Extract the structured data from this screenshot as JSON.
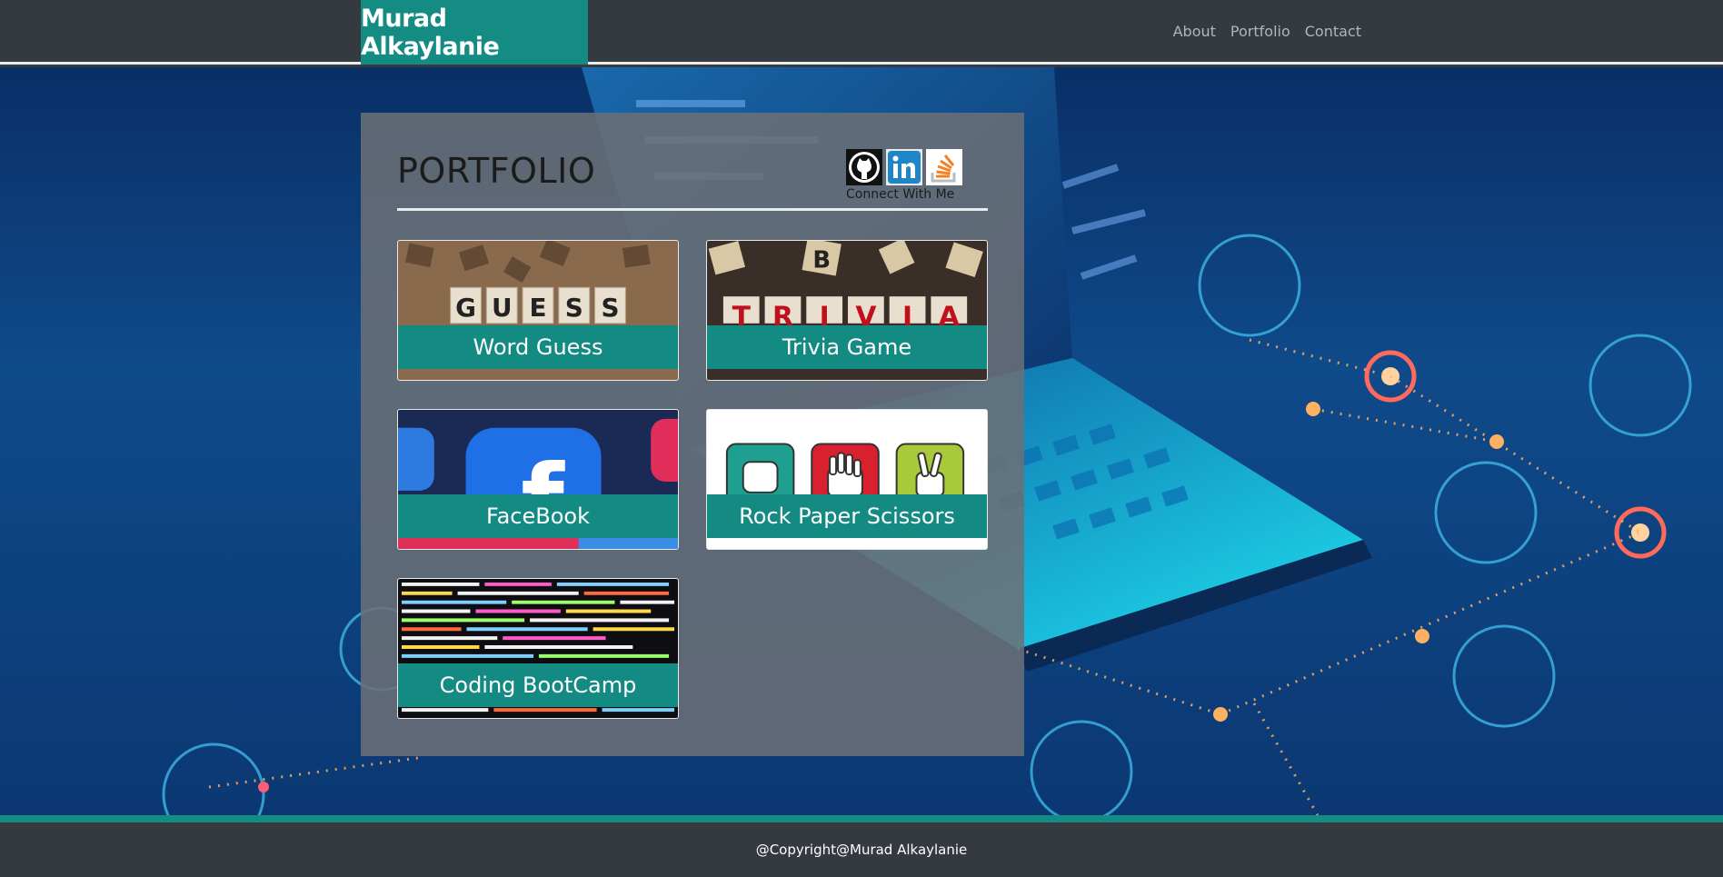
{
  "header": {
    "brand": "Murad Alkaylanie",
    "nav": [
      "About",
      "Portfolio",
      "Contact"
    ]
  },
  "portfolio": {
    "title": "PORTFOLIO",
    "connect_label": "Connect With Me",
    "social": [
      "github-icon",
      "linkedin-icon",
      "stackoverflow-icon"
    ],
    "projects": [
      {
        "label": "Word Guess",
        "tiles": "GUESS"
      },
      {
        "label": "Trivia Game",
        "tiles": "TRIVIA"
      },
      {
        "label": "FaceBook"
      },
      {
        "label": "Rock Paper Scissors"
      },
      {
        "label": "Coding BootCamp"
      }
    ]
  },
  "footer": {
    "copyright": "@Copyright@Murad Alkaylanie"
  },
  "colors": {
    "accent": "#148c84",
    "header_bg": "#343a40",
    "nav_text": "#adb5bd"
  }
}
